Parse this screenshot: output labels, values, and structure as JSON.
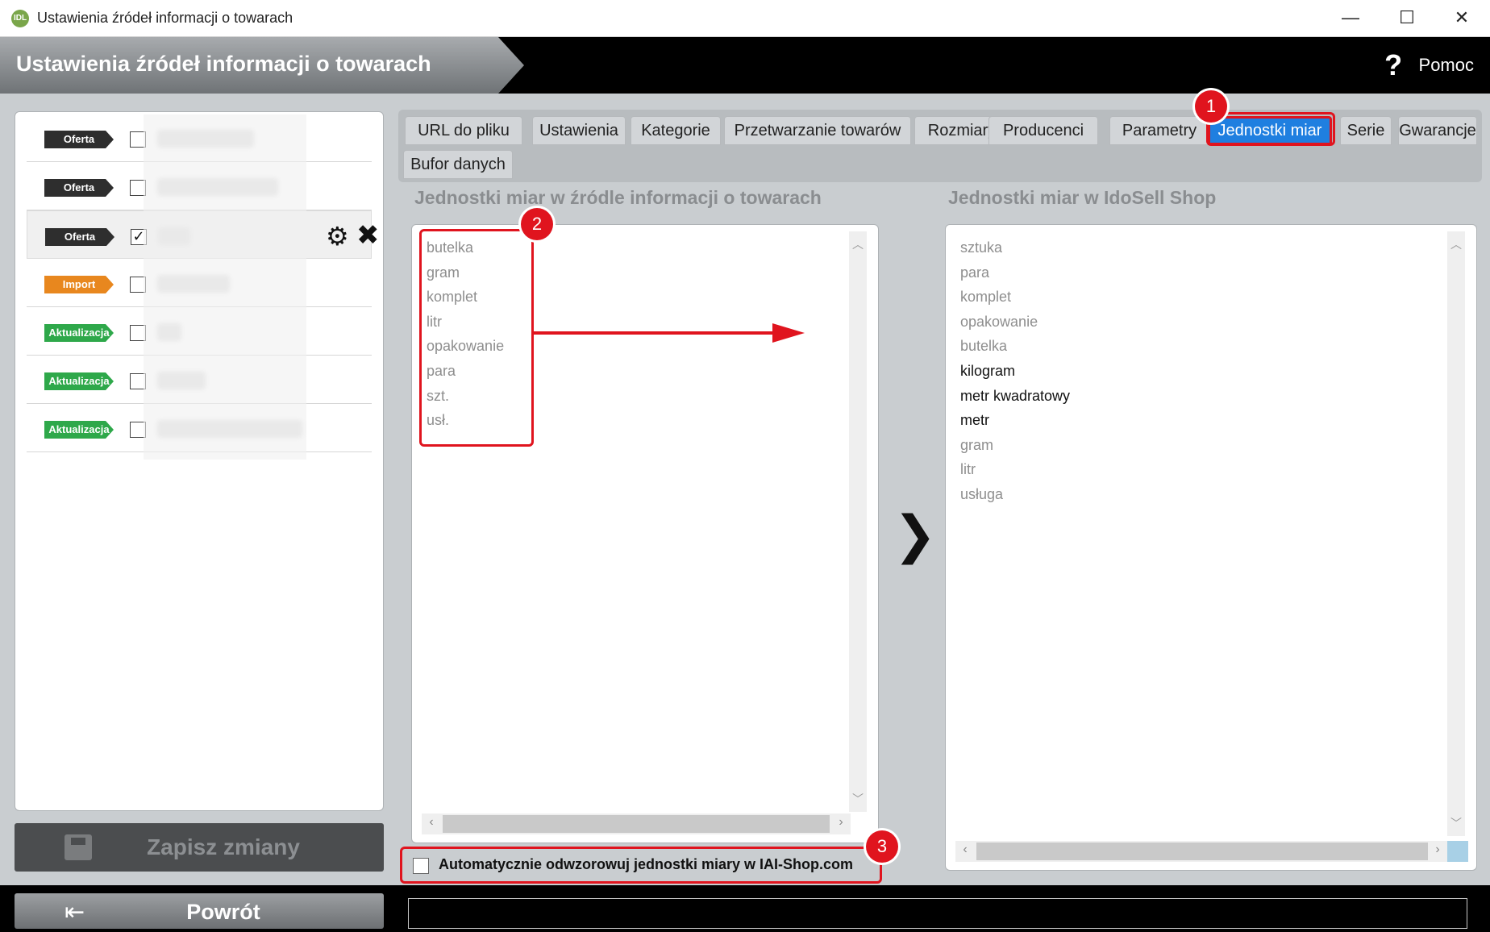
{
  "window": {
    "app_icon_text": "IDL",
    "title": "Ustawienia źródeł informacji o towarach",
    "controls": {
      "minimize": "—",
      "maximize": "☐",
      "close": "✕"
    }
  },
  "header": {
    "title": "Ustawienia źródeł informacji o towarach",
    "help_icon": "?",
    "help_label": "Pomoc"
  },
  "sources": [
    {
      "badge": "Oferta",
      "type": "oferta",
      "checked": false,
      "selected": false
    },
    {
      "badge": "Oferta",
      "type": "oferta",
      "checked": false,
      "selected": false
    },
    {
      "badge": "Oferta",
      "type": "oferta",
      "checked": true,
      "selected": true
    },
    {
      "badge": "Import",
      "type": "import",
      "checked": false,
      "selected": false
    },
    {
      "badge": "Aktualizacja",
      "type": "aktualizacja",
      "checked": false,
      "selected": false
    },
    {
      "badge": "Aktualizacja",
      "type": "aktualizacja",
      "checked": false,
      "selected": false
    },
    {
      "badge": "Aktualizacja",
      "type": "aktualizacja",
      "checked": false,
      "selected": false
    }
  ],
  "row_actions": {
    "gear_icon": "⚙",
    "delete_icon": "✖",
    "checkmark": "✓"
  },
  "buttons": {
    "save_label": "Zapisz zmiany",
    "back_label": "Powrót",
    "back_icon": "⇤"
  },
  "tabs": [
    {
      "label": "URL do pliku",
      "active": false
    },
    {
      "label": "Ustawienia",
      "active": false
    },
    {
      "label": "Kategorie",
      "active": false
    },
    {
      "label": "Przetwarzanie towarów",
      "active": false
    },
    {
      "label": "Rozmiary",
      "active": false
    },
    {
      "label": "Producenci",
      "active": false
    },
    {
      "label": "Parametry",
      "active": false
    },
    {
      "label": "Jednostki miar",
      "active": true
    },
    {
      "label": "Serie",
      "active": false
    },
    {
      "label": "Gwarancje",
      "active": false
    },
    {
      "label": "Bufor danych",
      "active": false
    }
  ],
  "source_units": {
    "title": "Jednostki miar w źródle informacji o towarach",
    "items": [
      "butelka",
      "gram",
      "komplet",
      "litr",
      "opakowanie",
      "para",
      "szt.",
      "usł."
    ]
  },
  "shop_units": {
    "title": "Jednostki miar w IdoSell Shop",
    "items": [
      {
        "label": "sztuka",
        "emphasis": false
      },
      {
        "label": "para",
        "emphasis": false
      },
      {
        "label": "komplet",
        "emphasis": false
      },
      {
        "label": "opakowanie",
        "emphasis": false
      },
      {
        "label": "butelka",
        "emphasis": false
      },
      {
        "label": "kilogram",
        "emphasis": true
      },
      {
        "label": "metr kwadratowy",
        "emphasis": true
      },
      {
        "label": "metr",
        "emphasis": true
      },
      {
        "label": "gram",
        "emphasis": false
      },
      {
        "label": "litr",
        "emphasis": false
      },
      {
        "label": "usługa",
        "emphasis": false
      }
    ]
  },
  "transfer_icon": "❯",
  "scroll_arrows": {
    "up": "︿",
    "down": "﹀",
    "left": "‹",
    "right": "›"
  },
  "auto_map": {
    "label": "Automatycznie odwzorowuj jednostki miary w IAI-Shop.com",
    "checked": false
  },
  "annotations": {
    "n1": "1",
    "n2": "2",
    "n3": "3"
  },
  "colors": {
    "active_tab": "#1f7fe0",
    "annotation": "#e0141e",
    "badge_oferta": "#2e2e2e",
    "badge_import": "#e8871e",
    "badge_aktualizacja": "#2ea84a"
  }
}
